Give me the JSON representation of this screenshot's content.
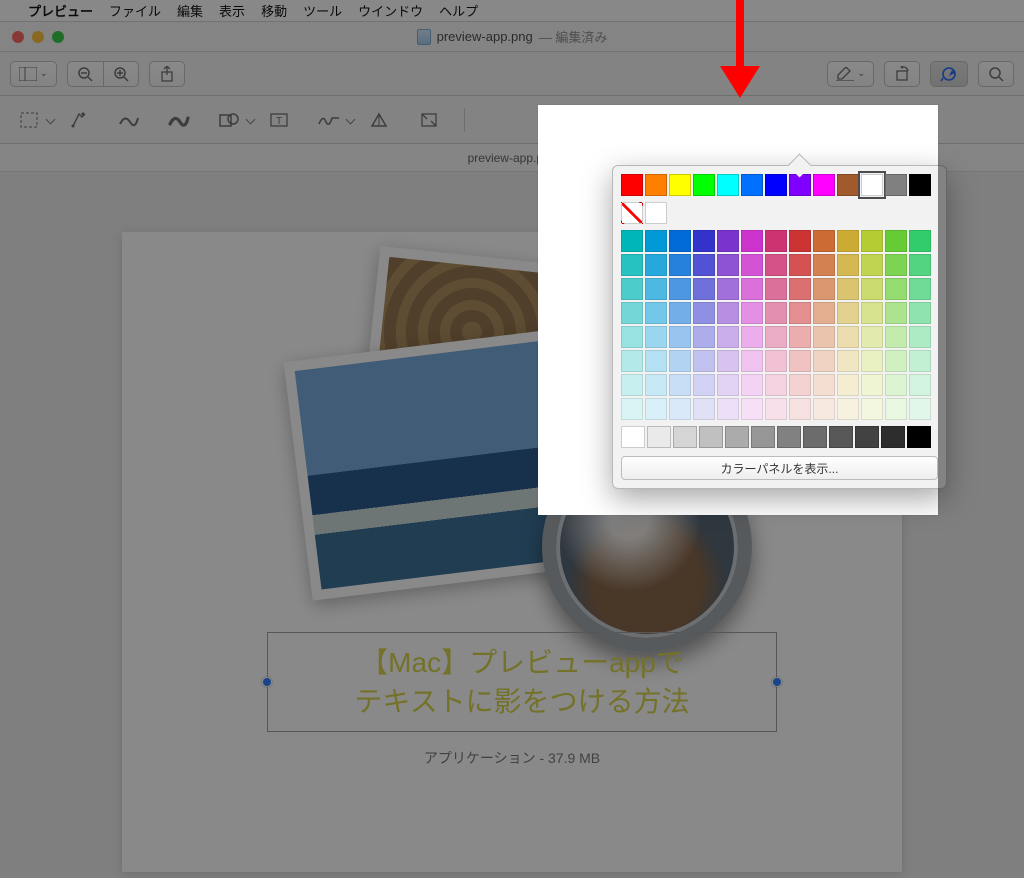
{
  "menubar": {
    "items": [
      "プレビュー",
      "ファイル",
      "編集",
      "表示",
      "移動",
      "ツール",
      "ウインドウ",
      "ヘルプ"
    ]
  },
  "window": {
    "title": "preview-app.png",
    "title_suffix": "— 編集済み"
  },
  "toolbar1_icons": [
    "sidebar-icon",
    "zoom-out-icon",
    "zoom-in-icon",
    "share-icon",
    "highlight-icon",
    "rotate-icon",
    "markup-icon",
    "search-icon"
  ],
  "toolbar2": {
    "left_icons": [
      "selection-icon",
      "instant-alpha-icon",
      "sketch-icon",
      "draw-icon",
      "shapes-icon",
      "text-icon",
      "signature-icon",
      "adjust-color-icon",
      "crop-icon"
    ],
    "right_icons": [
      "line-weight-icon",
      "border-color-icon",
      "fill-color-icon",
      "font-style-icon"
    ]
  },
  "doc_meta": {
    "filename": "preview-app.png"
  },
  "page": {
    "text_annotation": "【Mac】プレビューappで\nテキストに影をつける方法",
    "meta": "アプリケーション - 37.9 MB"
  },
  "popover": {
    "primary_colors": [
      "#ff0000",
      "#ff8000",
      "#ffff00",
      "#00ff00",
      "#00ffff",
      "#0070ff",
      "#0000ff",
      "#8000ff",
      "#ff00ff",
      "#a05a2c",
      "#ffffff",
      "#808080",
      "#000000"
    ],
    "selected_primary_index": 10,
    "show_panel_label": "カラーパネルを表示...",
    "grid_hues": [
      "#00b6b6",
      "#0099d6",
      "#006bd6",
      "#3333cc",
      "#7a33cc",
      "#cc33cc",
      "#cc3370",
      "#cc3333",
      "#cc6b33",
      "#ccab33",
      "#b6cc33",
      "#66cc33",
      "#33cc6b"
    ],
    "grid_light_steps": [
      1.0,
      0.85,
      0.7,
      0.55,
      0.4,
      0.3,
      0.22,
      0.15
    ],
    "no_fill_icon": "no-fill-icon",
    "gray_steps": [
      "#ffffff",
      "#eaeaea",
      "#d5d5d5",
      "#c0c0c0",
      "#ababab",
      "#969696",
      "#818181",
      "#6c6c6c",
      "#575757",
      "#424242",
      "#2d2d2d",
      "#000000"
    ]
  }
}
